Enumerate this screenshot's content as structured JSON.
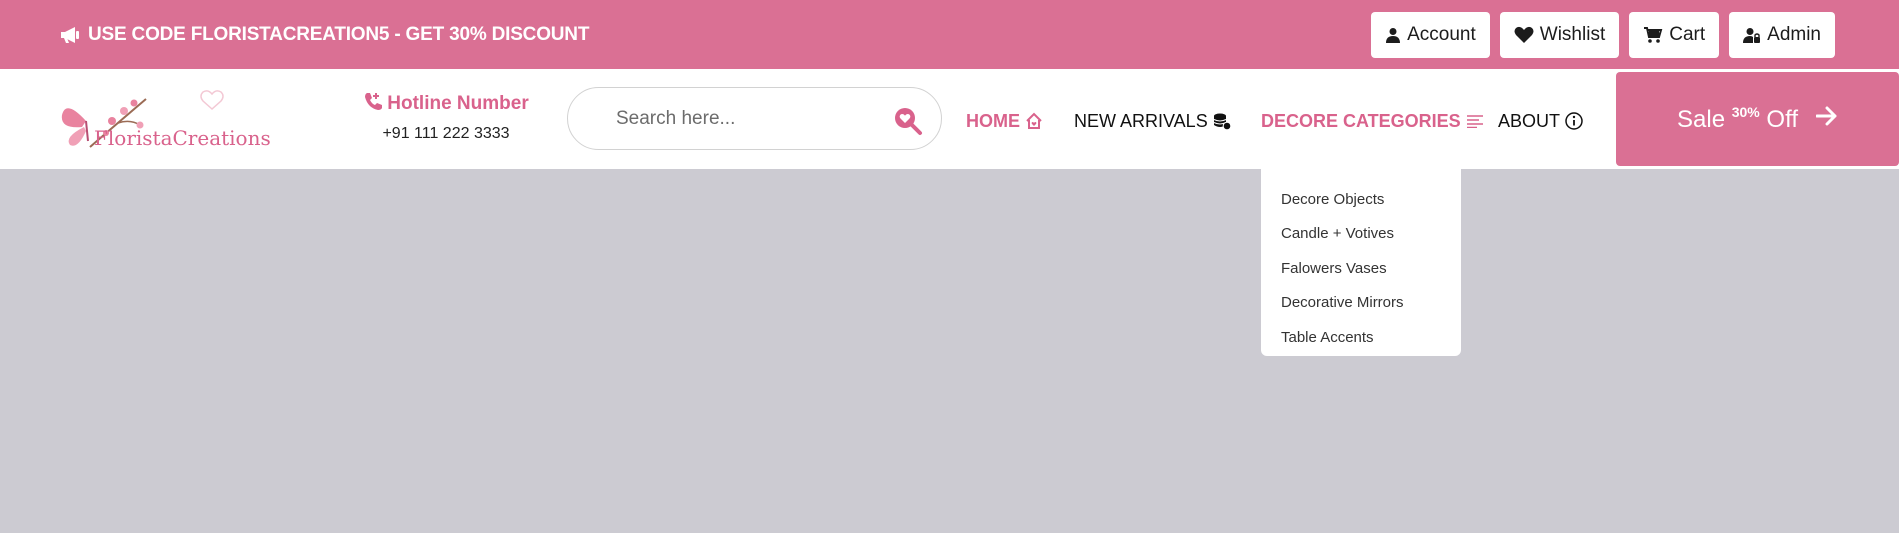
{
  "promo": {
    "text": "USE CODE FLORISTACREATION5 - GET 30% DISCOUNT",
    "icon": "megaphone-icon"
  },
  "top_buttons": [
    {
      "label": "Account",
      "icon": "user-icon"
    },
    {
      "label": "Wishlist",
      "icon": "heart-icon"
    },
    {
      "label": "Cart",
      "icon": "cart-icon"
    },
    {
      "label": "Admin",
      "icon": "admin-user-icon"
    }
  ],
  "logo": {
    "text": "FloristaCreations"
  },
  "hotline": {
    "title": "Hotline Number",
    "number": "+91 111 222 3333",
    "icon": "phone-icon"
  },
  "search": {
    "placeholder": "Search here...",
    "value": ""
  },
  "nav": {
    "home": "HOME",
    "new_arrivals": "NEW ARRIVALS",
    "decore_categories": "DECORE CATEGORIES",
    "about": "ABOUT"
  },
  "sale": {
    "prefix": "Sale",
    "percent": "30%",
    "suffix": "Off"
  },
  "dropdown": {
    "items": [
      "Decore Objects",
      "Candle + Votives",
      "Falowers Vases",
      "Decorative Mirrors",
      "Table Accents"
    ]
  },
  "colors": {
    "brand_pink": "#da7094",
    "nav_pink": "#d9628c",
    "page_bg": "#cccbd2"
  }
}
